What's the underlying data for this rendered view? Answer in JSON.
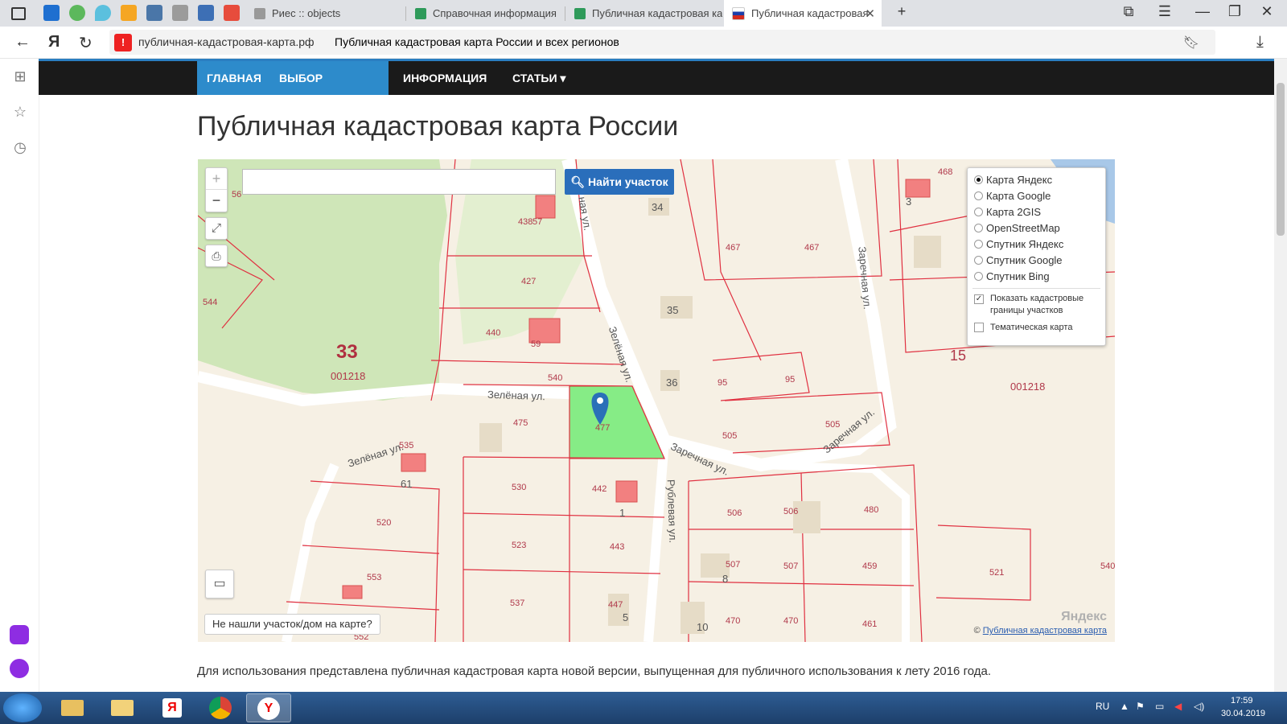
{
  "browser": {
    "tabs": [
      {
        "label": "Риес :: objects",
        "active": false
      },
      {
        "label": "Справочная информация",
        "active": false
      },
      {
        "label": "Публичная кадастровая ка",
        "active": false
      },
      {
        "label": "Публичная кадастровая",
        "active": true
      }
    ],
    "url_domain": "публичная-кадастровая-карта.рф",
    "url_title": "Публичная кадастровая карта России и всех регионов",
    "yandex_letter": "Я",
    "new_tab_symbol": "+"
  },
  "topnav": {
    "items": [
      "ГЛАВНАЯ",
      "ВЫБОР РЕГИОНА ▾",
      "ИНФОРМАЦИЯ",
      "СТАТЬИ ▾"
    ]
  },
  "page": {
    "title": "Публичная кадастровая карта России",
    "body_text": "Для использования представлена публичная кадастровая карта новой версии, выпущенная для публичного использования к лету 2016 года."
  },
  "map": {
    "zoom_in": "+",
    "zoom_out": "−",
    "search_placeholder": "",
    "search_button": "Найти участок",
    "layers": [
      "Карта Яндекс",
      "Карта Google",
      "Карта 2GIS",
      "OpenStreetMap",
      "Спутник Яндекс",
      "Спутник Google",
      "Спутник Bing"
    ],
    "selected_layer": "Карта Яндекс",
    "show_borders": "Показать кадастровые границы участков",
    "show_borders_checked": true,
    "thematic": "Тематическая карта",
    "thematic_checked": false,
    "not_found": "Не нашли участок/дом на карте?",
    "copyright_prefix": "© ",
    "copyright_link": "Публичная кадастровая карта",
    "yandex_logo": "Яндекс",
    "labels": {
      "quarter_33": "33",
      "quarter_001218_a": "001218",
      "quarter_15": "15",
      "quarter_001218_b": "001218",
      "street_zelenaya_1": "Зелёная ул.",
      "street_zelenaya_2": "Зелёная ул.",
      "street_zelenaya_3": "Зелёная ул.",
      "street_zarechnaya_1": "Заречная ул.",
      "street_zarechnaya_2": "Заречная ул.",
      "street_zarechnaya_3": "Заречная ул.",
      "street_rublevaya": "Рублевая ул.",
      "street_naya": "ная ул.",
      "parcels": [
        "56",
        "544",
        "438",
        "57",
        "427",
        "440",
        "59",
        "540",
        "475",
        "477",
        "535",
        "61",
        "520",
        "530",
        "442",
        "1",
        "523",
        "443",
        "553",
        "537",
        "447",
        "5",
        "552",
        "34",
        "35",
        "36",
        "467",
        "467",
        "95",
        "95",
        "505",
        "505",
        "506",
        "506",
        "480",
        "507",
        "507",
        "459",
        "8",
        "10",
        "470",
        "470",
        "461",
        "468",
        "3",
        "521",
        "540"
      ]
    }
  },
  "taskbar": {
    "lang": "RU",
    "time": "17:59",
    "date": "30.04.2019"
  }
}
